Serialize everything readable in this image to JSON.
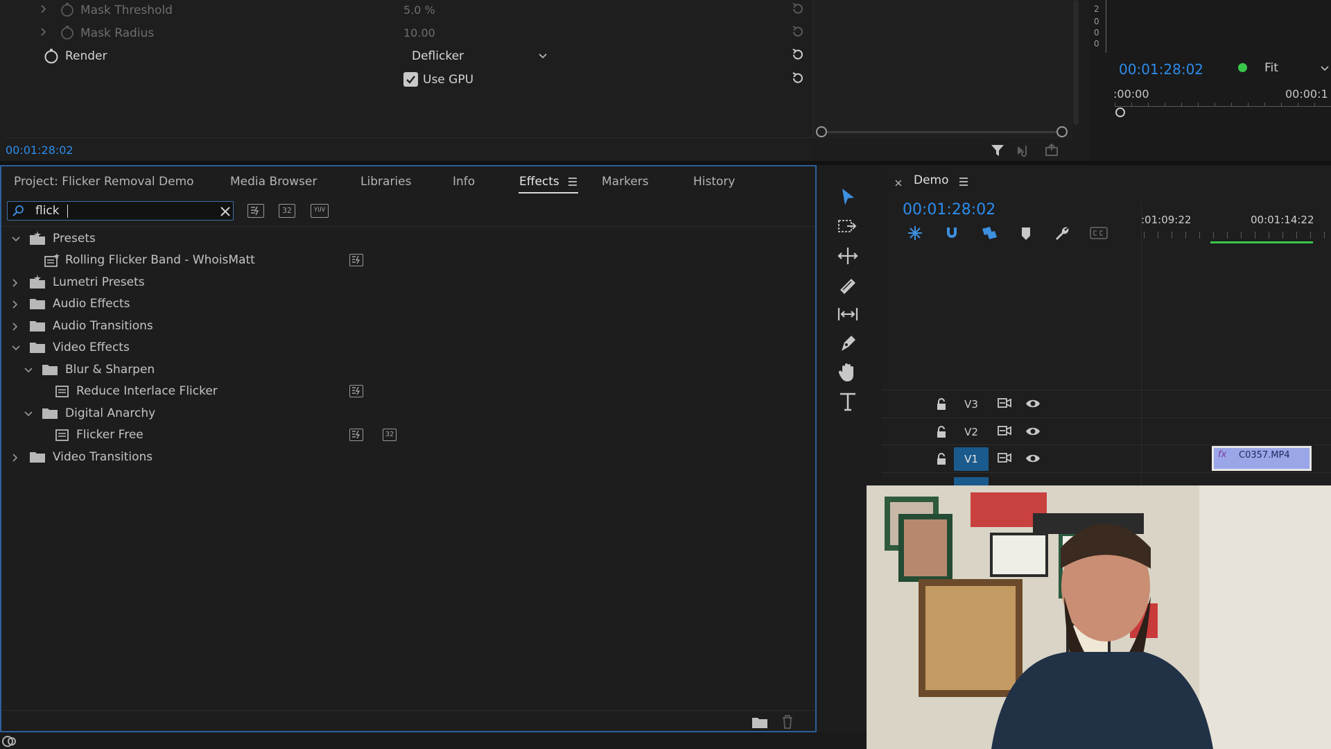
{
  "effect_controls": {
    "rows": [
      {
        "label": "Mask Threshold",
        "value": "5.0",
        "unit": "%",
        "dimmed": true
      },
      {
        "label": "Mask Radius",
        "value": "10.00",
        "dimmed": true
      },
      {
        "label": "Render",
        "value": "Deflicker",
        "dimmed": false
      }
    ],
    "use_gpu_label": "Use GPU",
    "use_gpu_checked": true,
    "timecode": "00:01:28:02"
  },
  "program_monitor": {
    "timecode": "00:01:28:02",
    "zoom": "Fit",
    "ruler_start": ":00:00",
    "ruler_next": "00:00:1",
    "meter_ticks": [
      "2",
      "0",
      "0",
      "0"
    ]
  },
  "effects_panel": {
    "tabs": [
      {
        "label": "Project: Flicker Removal Demo",
        "active": false
      },
      {
        "label": "Media Browser",
        "active": false
      },
      {
        "label": "Libraries",
        "active": false
      },
      {
        "label": "Info",
        "active": false
      },
      {
        "label": "Effects",
        "active": true
      },
      {
        "label": "Markers",
        "active": false
      },
      {
        "label": "History",
        "active": false
      }
    ],
    "search_value": "flick",
    "filter_badges": [
      "32",
      "YUV"
    ],
    "tree": [
      {
        "label": "Presets",
        "type": "preset-folder",
        "expanded": true,
        "level": 0
      },
      {
        "label": "Rolling Flicker Band - WhoisMatt",
        "type": "preset",
        "level": 1,
        "badges": [
          "accel"
        ]
      },
      {
        "label": "Lumetri Presets",
        "type": "preset-folder",
        "expanded": false,
        "level": 0
      },
      {
        "label": "Audio Effects",
        "type": "folder",
        "expanded": false,
        "level": 0
      },
      {
        "label": "Audio Transitions",
        "type": "folder",
        "expanded": false,
        "level": 0
      },
      {
        "label": "Video Effects",
        "type": "folder",
        "expanded": true,
        "level": 0
      },
      {
        "label": "Blur & Sharpen",
        "type": "folder",
        "expanded": true,
        "level": 1
      },
      {
        "label": "Reduce Interlace Flicker",
        "type": "effect",
        "level": 2,
        "badges": [
          "accel"
        ]
      },
      {
        "label": "Digital Anarchy",
        "type": "folder",
        "expanded": true,
        "level": 1
      },
      {
        "label": "Flicker Free",
        "type": "effect",
        "level": 2,
        "badges": [
          "accel",
          "32"
        ]
      },
      {
        "label": "Video Transitions",
        "type": "folder",
        "expanded": false,
        "level": 0
      }
    ]
  },
  "timeline": {
    "sequence_name": "Demo",
    "timecode": "00:01:28:02",
    "ruler_labels": [
      ":01:09:22",
      "00:01:14:22"
    ],
    "tracks": [
      {
        "name": "V3",
        "targeted": false
      },
      {
        "name": "V2",
        "targeted": false
      },
      {
        "name": "V1",
        "targeted": true
      }
    ],
    "clip_name": "C0357.MP4",
    "clip_fx": "fx"
  },
  "colors": {
    "accent_blue": "#2d8ceb",
    "panel_focus": "#2d5f9a",
    "clip_purple": "#9aa6e8",
    "playhead_green": "#39c84a"
  }
}
